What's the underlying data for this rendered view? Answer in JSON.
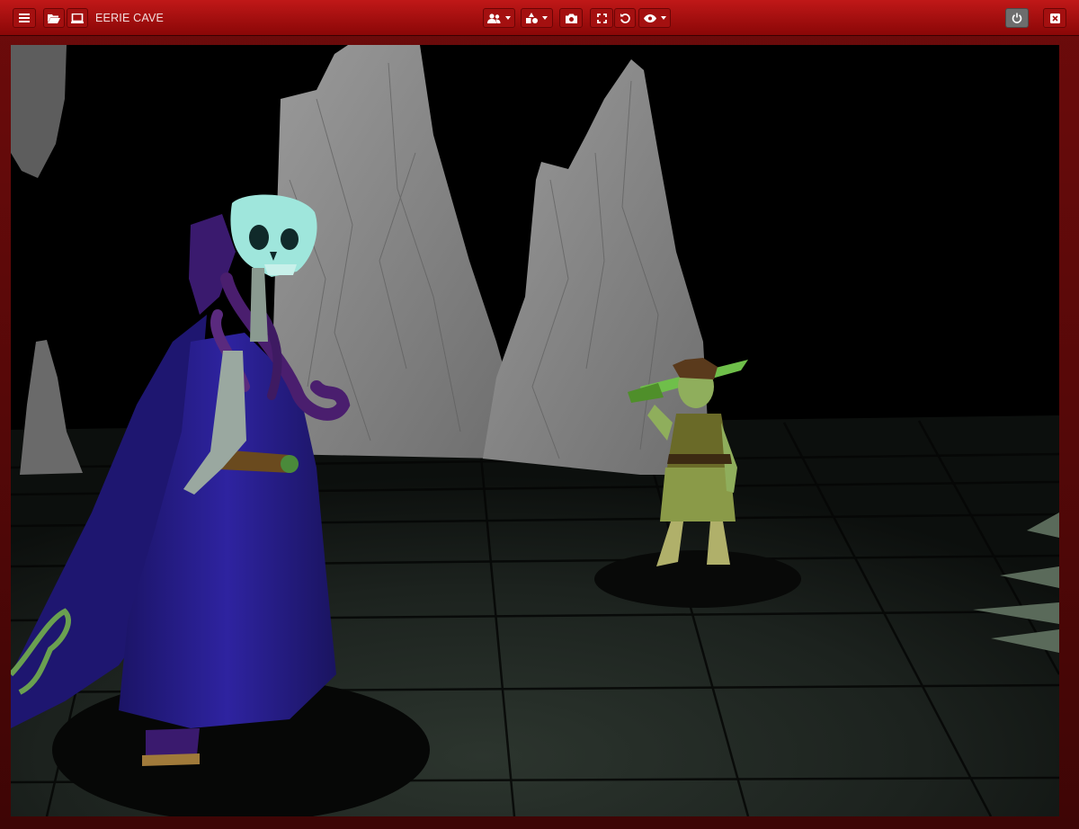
{
  "toolbar": {
    "scene_title": "EERIE CAVE",
    "buttons": [
      {
        "name": "menu-button",
        "icon": "hamburger-icon"
      },
      {
        "name": "open-folder-button",
        "icon": "folder-open-icon"
      },
      {
        "name": "monitor-button",
        "icon": "monitor-icon"
      },
      {
        "name": "characters-dropdown",
        "icon": "users-icon"
      },
      {
        "name": "shapes-dropdown",
        "icon": "shapes-icon"
      },
      {
        "name": "screenshot-button",
        "icon": "camera-icon"
      },
      {
        "name": "fullscreen-button",
        "icon": "expand-icon"
      },
      {
        "name": "reset-view-button",
        "icon": "undo-icon"
      },
      {
        "name": "visibility-dropdown",
        "icon": "eye-icon"
      },
      {
        "name": "power-button",
        "icon": "power-icon"
      },
      {
        "name": "close-button",
        "icon": "close-icon"
      }
    ]
  },
  "colors": {
    "toolbar_red": "#b41212",
    "frame_dark_red": "#5a0a0a",
    "floor": "#222a24",
    "rock": "#8a8a8a",
    "robe": "#2a1e8a",
    "skull": "#9fe6dc"
  }
}
